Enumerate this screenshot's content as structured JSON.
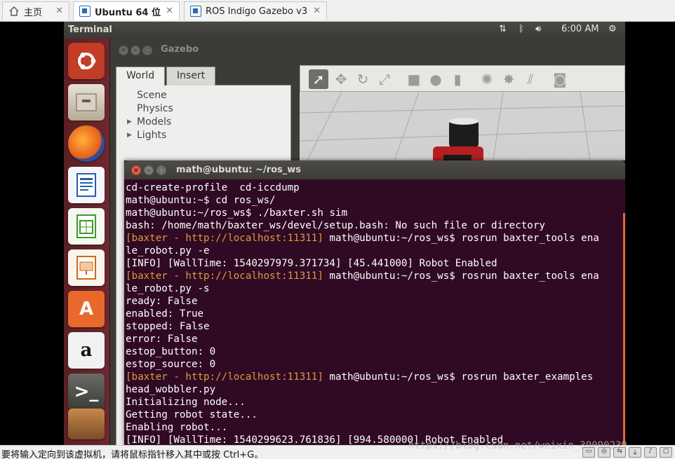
{
  "host_tabs": [
    {
      "label": "主页",
      "icon": "home-icon"
    },
    {
      "label": "Ubuntu 64 位",
      "icon": "vm-icon"
    },
    {
      "label": "ROS Indigo Gazebo v3",
      "icon": "vm-icon"
    }
  ],
  "panel": {
    "title": "Terminal",
    "time": "6:00 AM"
  },
  "gazebo": {
    "title": "Gazebo",
    "tabs": [
      "World",
      "Insert"
    ],
    "tree": [
      "Scene",
      "Physics",
      "Models",
      "Lights"
    ]
  },
  "terminal": {
    "title": "math@ubuntu: ~/ros_ws",
    "lines": [
      {
        "text": "cd-create-profile  cd-iccdump"
      },
      {
        "text": "math@ubuntu:~$ cd ros_ws/"
      },
      {
        "text": "math@ubuntu:~/ros_ws$ ./baxter.sh sim"
      },
      {
        "text": "bash: /home/math/baxter_ws/devel/setup.bash: No such file or directory"
      },
      {
        "prefix": "[baxter - http://localhost:11311]",
        "text": " math@ubuntu:~/ros_ws$ rosrun baxter_tools ena"
      },
      {
        "text": "le_robot.py -e"
      },
      {
        "text": "[INFO] [WallTime: 1540297979.371734] [45.441000] Robot Enabled"
      },
      {
        "prefix": "[baxter - http://localhost:11311]",
        "text": " math@ubuntu:~/ros_ws$ rosrun baxter_tools ena"
      },
      {
        "text": "le_robot.py -s"
      },
      {
        "text": "ready: False"
      },
      {
        "text": "enabled: True"
      },
      {
        "text": "stopped: False"
      },
      {
        "text": "error: False"
      },
      {
        "text": "estop_button: 0"
      },
      {
        "text": "estop_source: 0"
      },
      {
        "prefix": "[baxter - http://localhost:11311]",
        "text": " math@ubuntu:~/ros_ws$ rosrun baxter_examples"
      },
      {
        "text": "head_wobbler.py"
      },
      {
        "text": "Initializing node..."
      },
      {
        "text": "Getting robot state..."
      },
      {
        "text": "Enabling robot..."
      },
      {
        "text": "[INFO] [WallTime: 1540299623.761836] [994.580000] Robot Enabled"
      }
    ]
  },
  "statusbar": {
    "message": "要将输入定向到该虚拟机，请将鼠标指针移入其中或按 Ctrl+G。",
    "watermark": "https://blog.csdn.net/weixin_39090239"
  }
}
